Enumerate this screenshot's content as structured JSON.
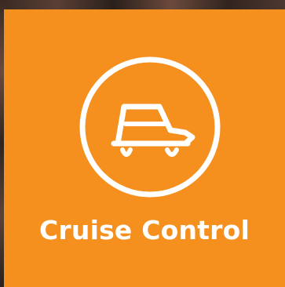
{
  "tile": {
    "label": "Cruise Control",
    "icon": "car-icon",
    "background_color": "#f5901f",
    "foreground_color": "#ffffff"
  }
}
